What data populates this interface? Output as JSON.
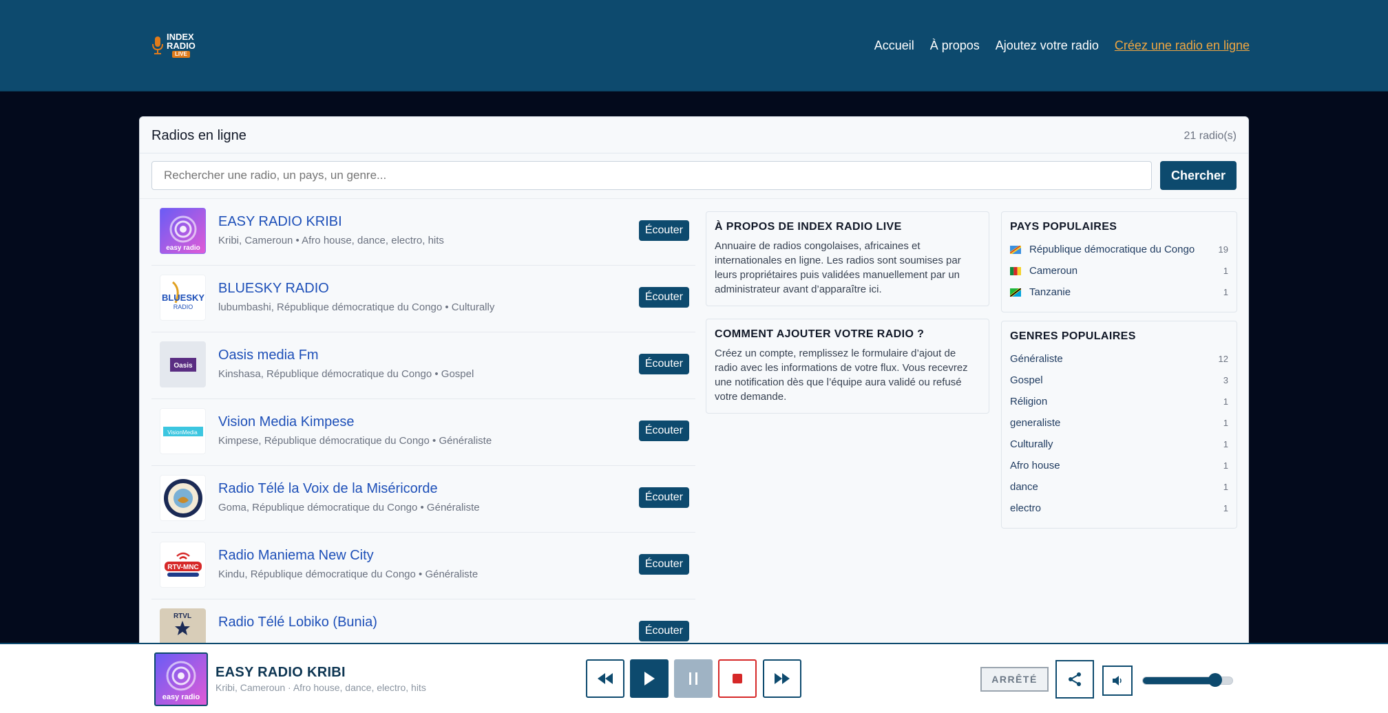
{
  "header": {
    "logo": {
      "line1": "INDEX",
      "line2": "RADIO",
      "badge": "LIVE"
    },
    "nav": [
      {
        "label": "Accueil"
      },
      {
        "label": "À propos"
      },
      {
        "label": "Ajoutez votre radio"
      },
      {
        "label": "Créez une radio en ligne"
      }
    ]
  },
  "main": {
    "title": "Radios en ligne",
    "count": "21 radio(s)",
    "search": {
      "placeholder": "Rechercher une radio, un pays, un genre...",
      "button": "Chercher"
    },
    "listen_label": "Écouter",
    "radios": [
      {
        "name": "EASY RADIO KRIBI",
        "meta": "Kribi, Cameroun • Afro house, dance, electro, hits",
        "logo_text": "easy radio"
      },
      {
        "name": "BLUESKY RADIO",
        "meta": "lubumbashi, République démocratique du Congo • Culturally",
        "logo_text": "BLUESKY"
      },
      {
        "name": "Oasis media Fm",
        "meta": "Kinshasa, République démocratique du Congo • Gospel",
        "logo_text": "Oasis"
      },
      {
        "name": "Vision Media Kimpese",
        "meta": "Kimpese, République démocratique du Congo • Généraliste",
        "logo_text": "VisionMedia"
      },
      {
        "name": "Radio Télé la Voix de la Miséricorde",
        "meta": "Goma, République démocratique du Congo • Généraliste",
        "logo_text": ""
      },
      {
        "name": "Radio Maniema New City",
        "meta": "Kindu, République démocratique du Congo • Généraliste",
        "logo_text": "RTV-MNC"
      },
      {
        "name": "Radio Télé Lobiko (Bunia)",
        "meta": "",
        "logo_text": "RTVL"
      }
    ]
  },
  "about": {
    "title": "À PROPOS DE INDEX RADIO LIVE",
    "text": "Annuaire de radios congolaises, africaines et internationales en ligne. Les radios sont soumises par leurs propriétaires puis validées manuellement par un administrateur avant d’apparaître ici."
  },
  "howto": {
    "title": "COMMENT AJOUTER VOTRE RADIO ?",
    "text": "Créez un compte, remplissez le formulaire d’ajout de radio avec les informations de votre flux. Vous recevrez une notification dès que l’équipe aura validé ou refusé votre demande."
  },
  "countries": {
    "title": "PAYS POPULAIRES",
    "items": [
      {
        "label": "République démocratique du Congo",
        "count": "19",
        "flag": "drc"
      },
      {
        "label": "Cameroun",
        "count": "1",
        "flag": "cameroon"
      },
      {
        "label": "Tanzanie",
        "count": "1",
        "flag": "tanzania"
      }
    ]
  },
  "genres": {
    "title": "GENRES POPULAIRES",
    "items": [
      {
        "label": "Généraliste",
        "count": "12"
      },
      {
        "label": "Gospel",
        "count": "3"
      },
      {
        "label": "Réligion",
        "count": "1"
      },
      {
        "label": "generaliste",
        "count": "1"
      },
      {
        "label": "Culturally",
        "count": "1"
      },
      {
        "label": "Afro house",
        "count": "1"
      },
      {
        "label": "dance",
        "count": "1"
      },
      {
        "label": "electro",
        "count": "1"
      }
    ]
  },
  "player": {
    "title": "EASY RADIO KRIBI",
    "meta": "Kribi, Cameroun · Afro house, dance, electro, hits",
    "status": "ARRÊTÉ",
    "volume": 0.8,
    "icons": [
      "rewind-icon",
      "play-icon",
      "pause-icon",
      "stop-icon",
      "forward-icon",
      "share-icon",
      "speaker-icon"
    ]
  },
  "colors": {
    "primary": "#0d4a6e",
    "accent": "#f0a742",
    "link": "#1d4fb8",
    "stop": "#d62828"
  }
}
